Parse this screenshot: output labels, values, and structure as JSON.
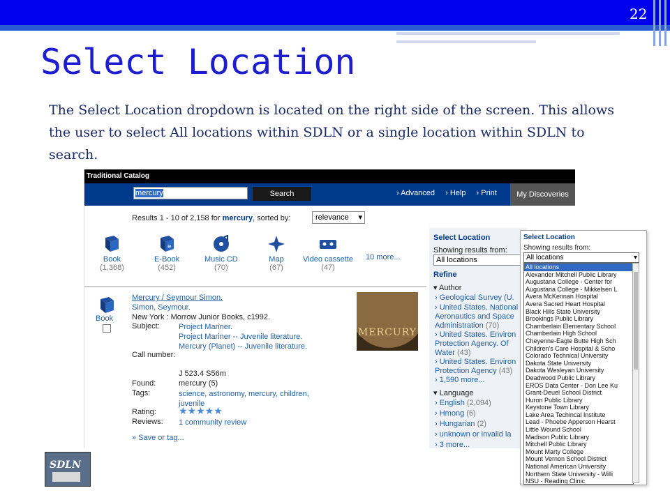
{
  "slide": {
    "number": "22",
    "title": "Select Location",
    "body": "The Select Location dropdown is located on the right side of the screen. This allows the user to select All locations within SDLN or a single location within SDLN to search.",
    "logo_text": "SDLN"
  },
  "catalog": {
    "header": "Traditional Catalog",
    "search_value": "mercury",
    "search_button": "Search",
    "nav_links": [
      "› Advanced",
      "› Help",
      "› Print"
    ],
    "my_discoveries": "My Discoveries",
    "results_prefix": "Results 1 - 10 of 2,158 for",
    "results_term": "mercury",
    "results_suffix": ", sorted by:",
    "sort_value": "relevance",
    "formats": [
      {
        "label": "Book",
        "count": "(1,368)",
        "icon": "book-icon"
      },
      {
        "label": "E-Book",
        "count": "(452)",
        "icon": "ebook-icon"
      },
      {
        "label": "Music CD",
        "count": "(70)",
        "icon": "music-cd-icon"
      },
      {
        "label": "Map",
        "count": "(67)",
        "icon": "map-icon"
      },
      {
        "label": "Video cassette",
        "count": "(47)",
        "icon": "video-cassette-icon"
      }
    ],
    "formats_more": "10 more...",
    "record": {
      "format_label": "Book",
      "title_link": "Mercury / Seymour Simon.",
      "author": "Simon, Seymour.",
      "publisher": "New York : Morrow Junior Books, c1992.",
      "subject_label": "Subject:",
      "subjects": [
        "Project Mariner.",
        "Project Mariner -- Juvenile literature.",
        "Mercury (Planet) -- Juvenile literature."
      ],
      "call_label": "Call number:",
      "call_number": "J 523.4 S56m",
      "found_label": "Found:",
      "found_value": "mercury (5)",
      "tags_label": "Tags:",
      "tags_value": "science, astronomy, mercury, children, juvenile",
      "rating_label": "Rating:",
      "rating_stars": "★★★★★",
      "reviews_label": "Reviews:",
      "reviews_value": "1 community review",
      "save_link": "» Save or tag...",
      "cover_text": "MERCURY"
    },
    "sidebar": {
      "title": "Select Location",
      "showing": "Showing results from:",
      "location_value": "All locations",
      "refine": "Refine",
      "author_heading": "Author",
      "authors": [
        {
          "name": "Geological Survey (U.",
          "count": ""
        },
        {
          "name": "United States. National Aeronautics and Space Administration",
          "count": "(70)"
        },
        {
          "name": "United States. Environ Protection Agency. Of Water",
          "count": "(43)"
        },
        {
          "name": "United States. Environ Protection Agency",
          "count": "(43)"
        },
        {
          "name": "1,590 more...",
          "count": ""
        }
      ],
      "language_heading": "Language",
      "languages": [
        {
          "name": "English",
          "count": "(2,094)"
        },
        {
          "name": "Hmong",
          "count": "(6)"
        },
        {
          "name": "Hungarian",
          "count": "(2)"
        },
        {
          "name": "unknown or invalid la",
          "count": ""
        },
        {
          "name": "3 more...",
          "count": ""
        }
      ]
    }
  },
  "dropdown": {
    "title": "Select Location",
    "showing": "Showing results from:",
    "selected": "All locations",
    "options": [
      "All locations",
      "Alexander Mitchell Public Library",
      "Augustana College - Center for",
      "Augustana College - Mikkelsen L",
      "Avera McKennan Hospital",
      "Avera Sacred Heart Hospital",
      "Black Hills State University",
      "Brookings Public Library",
      "Chamberlain Elementary School",
      "Chamberlain High School",
      "Cheyenne-Eagle Butte High Sch",
      "Children's Care Hospital & Scho",
      "Colorado Technical University",
      "Dakota State University",
      "Dakota Wesleyan University",
      "Deadwood Public Library",
      "EROS Data Center - Don Lee Ku",
      "Grant-Deuel School District",
      "Huron Public Library",
      "Keystone Town Library",
      "Lake Area Techincal Institute",
      "Lead - Phoebe Apperson Hearst",
      "Little Wound School",
      "Madison Public Library",
      "Mitchell Public Library",
      "Mount Marty College",
      "Mount Vernon School District",
      "National American University",
      "Northern State University - Willi",
      "NSU - Reading Clinic"
    ]
  },
  "colors": {
    "title": "#1d1dd0",
    "topbar": "#0000ee",
    "link": "#1f5fa8",
    "nav": "#003a8c",
    "highlight": "#316ac5"
  }
}
